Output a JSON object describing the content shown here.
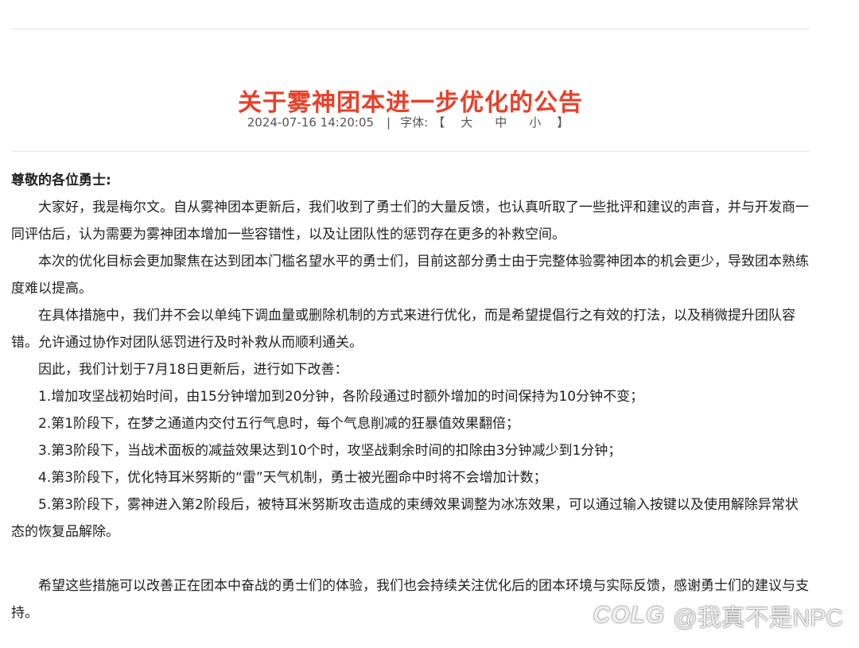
{
  "article": {
    "title": "关于雾神团本进一步优化的公告",
    "datetime": "2024-07-16 14:20:05",
    "separator": "|",
    "font_label": "字体:",
    "bracket_open": "【",
    "bracket_close": "】",
    "font_sizes": [
      "大",
      "中",
      "小"
    ],
    "salutation": "尊敬的各位勇士:",
    "paragraphs": [
      "大家好，我是梅尔文。自从雾神团本更新后，我们收到了勇士们的大量反馈，也认真听取了一些批评和建议的声音，并与开发商一同评估后，认为需要为雾神团本增加一些容错性，以及让团队性的惩罚存在更多的补救空间。",
      "本次的优化目标会更加聚焦在达到团本门槛名望水平的勇士们，目前这部分勇士由于完整体验雾神团本的机会更少，导致团本熟练度难以提高。",
      "在具体措施中，我们并不会以单纯下调血量或删除机制的方式来进行优化，而是希望提倡行之有效的打法，以及稍微提升团队容错。允许通过协作对团队惩罚进行及时补救从而顺利通关。",
      "因此，我们计划于7月18日更新后，进行如下改善：",
      "1.增加攻坚战初始时间，由15分钟增加到20分钟，各阶段通过时额外增加的时间保持为10分钟不变；",
      "2.第1阶段下，在梦之通道内交付五行气息时，每个气息削减的狂暴值效果翻倍；",
      "3.第3阶段下，当战术面板的减益效果达到10个时，攻坚战剩余时间的扣除由3分钟减少到1分钟；",
      "4.第3阶段下，优化特耳米努斯的“雷”天气机制，勇士被光圈命中时将不会增加计数；",
      "5.第3阶段下，雾神进入第2阶段后，被特耳米努斯攻击造成的束缚效果调整为冰冻效果，可以通过输入按键以及使用解除异常状态的恢复品解除。",
      "",
      "希望这些措施可以改善正在团本中奋战的勇士们的体验，我们也会持续关注优化后的团本环境与实际反馈，感谢勇士们的建议与支持。"
    ]
  },
  "watermark": {
    "logo": "COLG",
    "handle": "@我真不是NPC"
  }
}
